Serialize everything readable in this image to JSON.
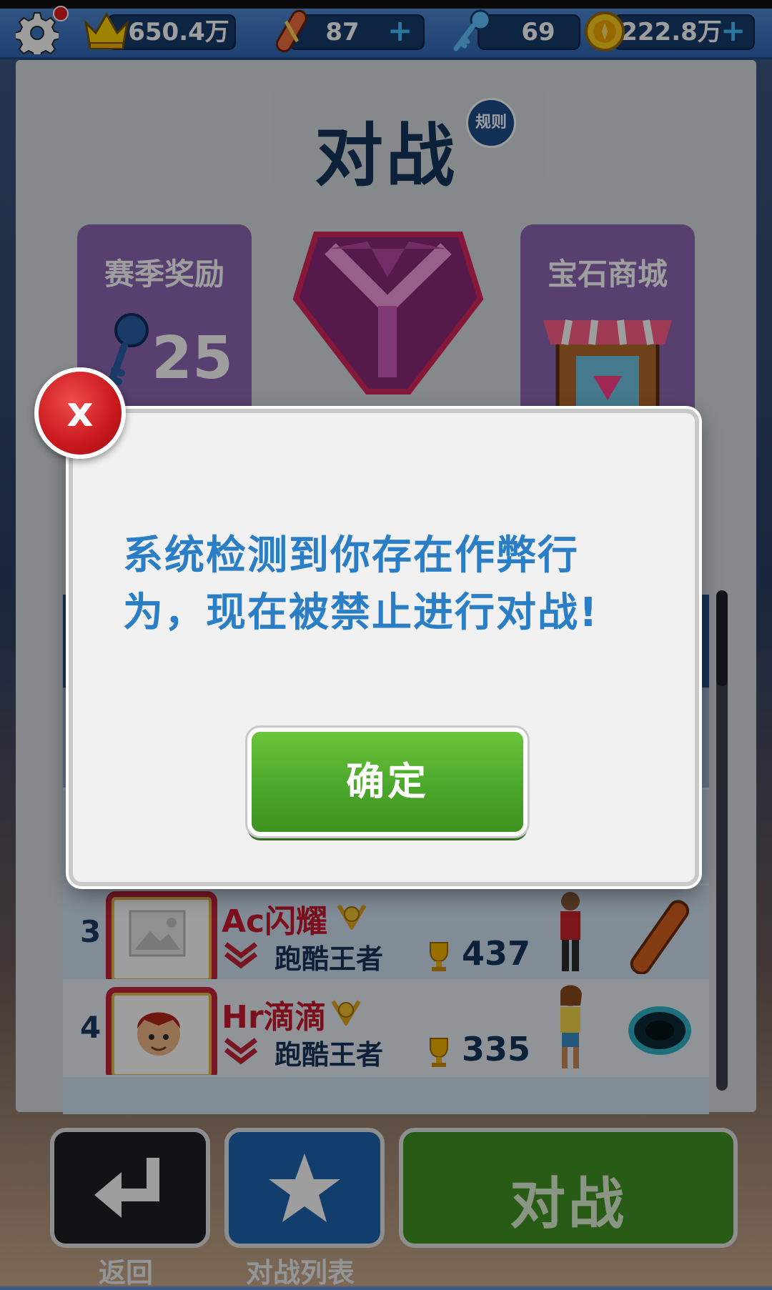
{
  "topbar": {
    "crowns": "650.4万",
    "boards": "87",
    "keys": "69",
    "coins": "222.8万",
    "plus": "+"
  },
  "panel": {
    "title": "对战",
    "rules_label": "规则",
    "season_rewards": {
      "label": "赛季奖励",
      "value": "25"
    },
    "gem_store": {
      "label": "宝石商城"
    }
  },
  "leaderboard": [
    {
      "rank": "3",
      "name": "Ac闪耀",
      "tier": "跑酷王者",
      "score": "437"
    },
    {
      "rank": "4",
      "name": "Hr滴滴",
      "tier": "跑酷王者",
      "score": "335"
    }
  ],
  "bottom": {
    "back_label": "返回",
    "list_label": "对战列表",
    "fight_label": "对战"
  },
  "modal": {
    "close_label": "x",
    "message": "系统检测到你存在作弊行为，现在被禁止进行对战!",
    "confirm_label": "确定"
  },
  "colors": {
    "topbar": "#3a78c6",
    "modal_text": "#2a7ec6",
    "confirm_green": "#4aa72a",
    "close_red": "#c8181d",
    "player_name_red": "#c7192e"
  }
}
